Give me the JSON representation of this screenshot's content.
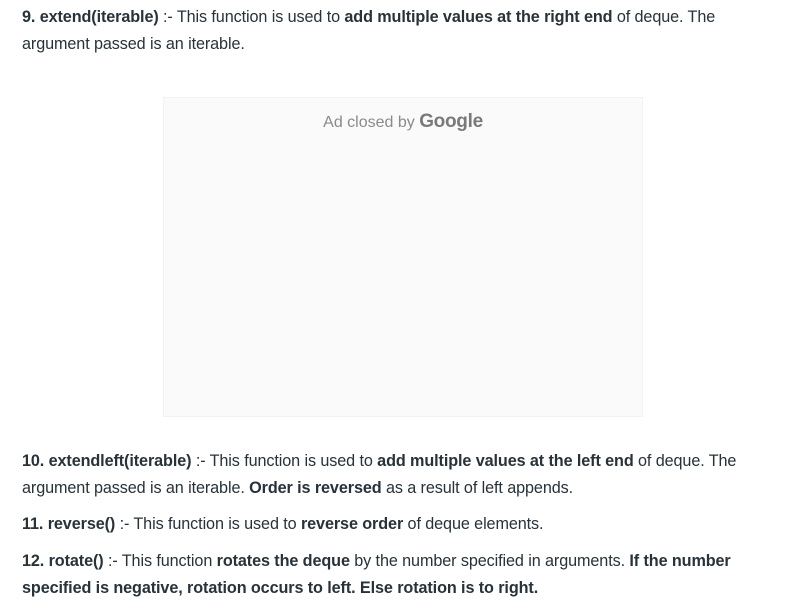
{
  "items": [
    {
      "id": "9",
      "segments": [
        {
          "text": "9. extend(iterable)",
          "bold": true
        },
        {
          "text": " :- This function is used to ",
          "bold": false
        },
        {
          "text": "add multiple values at the right end",
          "bold": true
        },
        {
          "text": " of deque. The argument passed is an iterable.",
          "bold": false
        }
      ]
    },
    {
      "id": "10",
      "segments": [
        {
          "text": "10. extendleft(iterable)",
          "bold": true
        },
        {
          "text": " :- This function is used to ",
          "bold": false
        },
        {
          "text": "add multiple values at the left end",
          "bold": true
        },
        {
          "text": " of deque. The argument passed is an iterable. ",
          "bold": false
        },
        {
          "text": "Order is reversed",
          "bold": true
        },
        {
          "text": " as a result of left appends.",
          "bold": false
        }
      ]
    },
    {
      "id": "11",
      "segments": [
        {
          "text": "11. reverse()",
          "bold": true
        },
        {
          "text": " :- This function is used to ",
          "bold": false
        },
        {
          "text": "reverse order",
          "bold": true
        },
        {
          "text": " of deque elements.",
          "bold": false
        }
      ]
    },
    {
      "id": "12",
      "segments": [
        {
          "text": "12. rotate()",
          "bold": true
        },
        {
          "text": " :- This function ",
          "bold": false
        },
        {
          "text": "rotates the deque",
          "bold": true
        },
        {
          "text": " by the number specified in arguments. ",
          "bold": false
        },
        {
          "text": "If the number specified is negative, rotation occurs to left. Else rotation is to right.",
          "bold": true
        }
      ]
    }
  ],
  "ad": {
    "label_prefix": "Ad closed by ",
    "label_brand": "Google"
  }
}
